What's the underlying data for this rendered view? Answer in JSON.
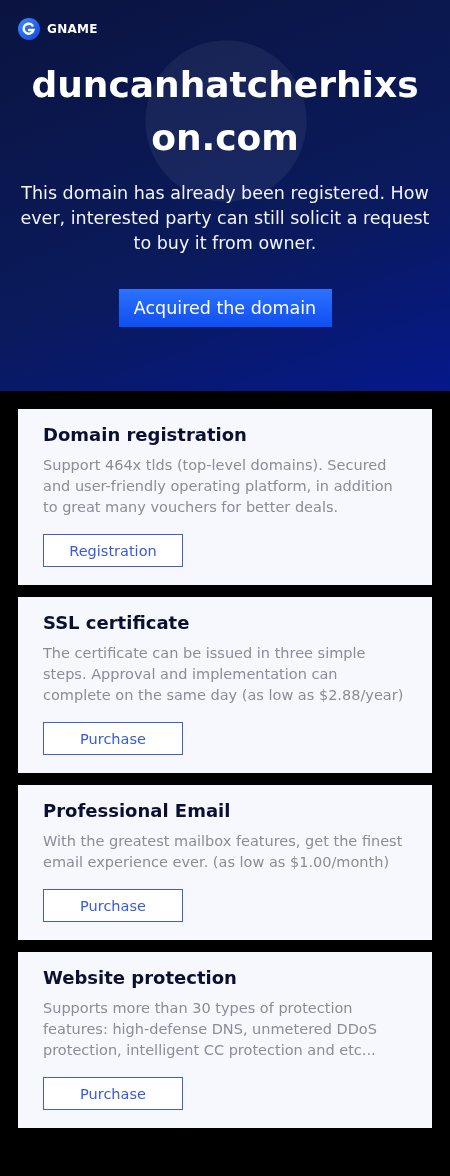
{
  "brand": {
    "name": "GNAME"
  },
  "hero": {
    "domain": "duncanhatcherhixson.com",
    "message": "This domain has already been registered. However, interested party can still solicit a request to buy it from owner.",
    "button": "Acquired the domain"
  },
  "services": [
    {
      "title": "Domain registration",
      "description": "Support 464x tlds (top-level domains). Secured and user-friendly operating platform, in addition to great many vouchers for better deals.",
      "button": "Registration"
    },
    {
      "title": "SSL certificate",
      "description": "The certificate can be issued in three simple steps. Approval and implementation can complete on the same day (as low as $2.88/year)",
      "button": "Purchase"
    },
    {
      "title": "Professional Email",
      "description": "With the greatest mailbox features, get the finest email experience ever. (as low as $1.00/month)",
      "button": "Purchase"
    },
    {
      "title": "Website protection",
      "description": "Supports more than 30 types of protection features: high-defense DNS, unmetered DDoS protection, intelligent CC protection and etc...",
      "button": "Purchase"
    }
  ]
}
